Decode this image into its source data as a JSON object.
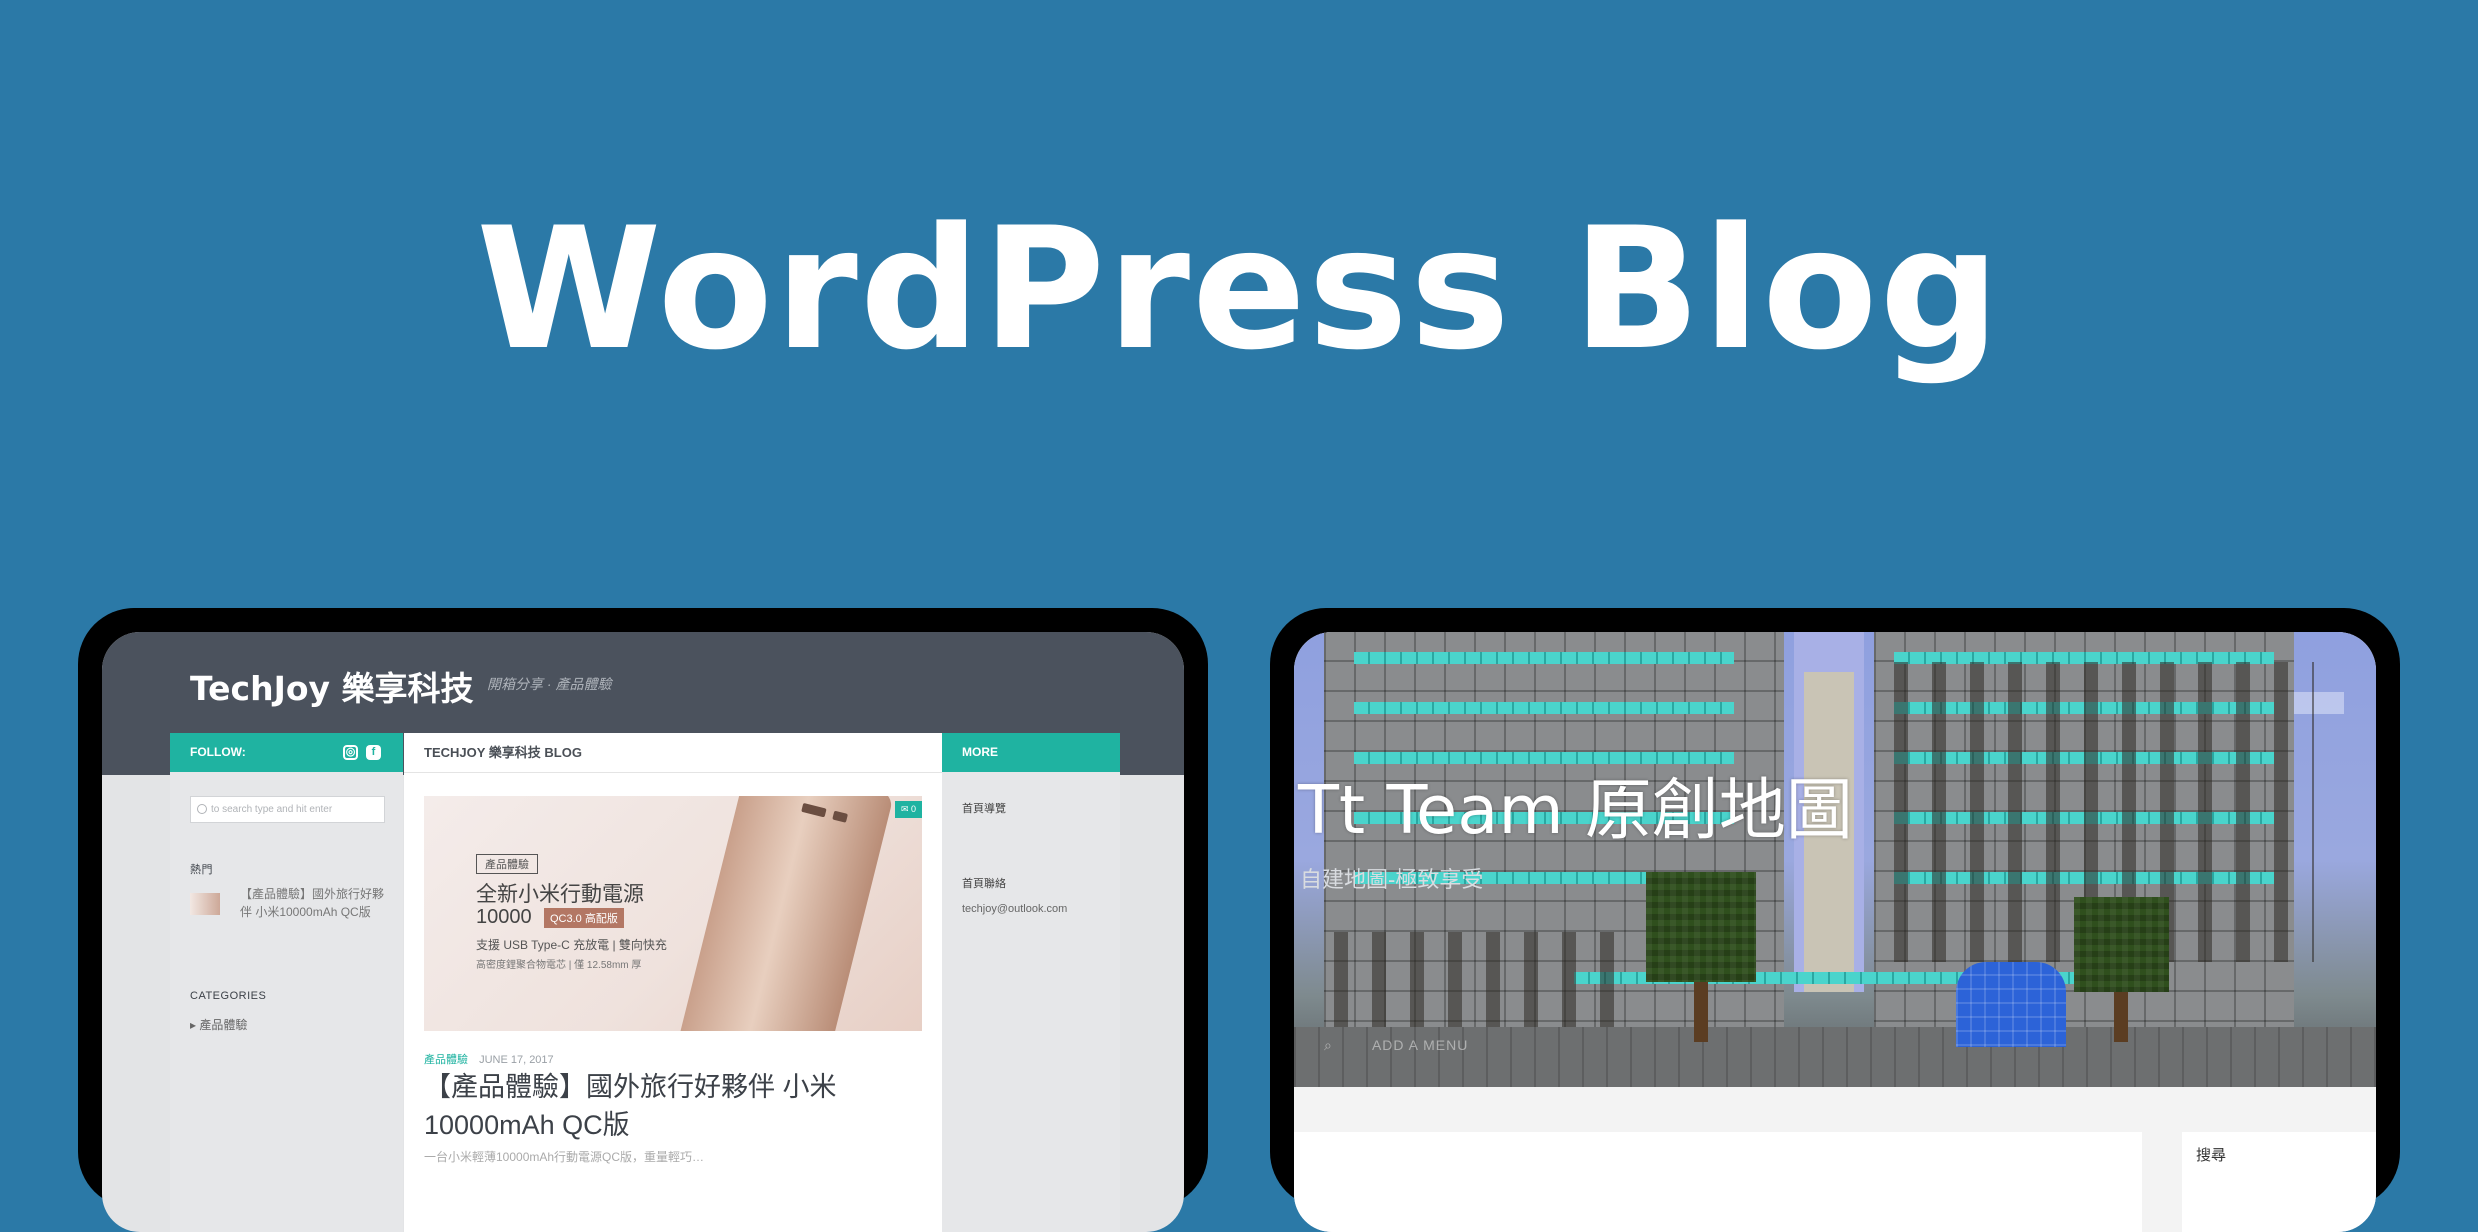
{
  "headline": "WordPress Blog",
  "left_screen": {
    "logo": "TechJoy 樂享科技",
    "tagline": "開箱分享 · 產品體驗",
    "follow_label": "FOLLOW:",
    "blog_label": "TECHJOY 樂享科技 BLOG",
    "more_label": "MORE",
    "search_placeholder": "to search type and hit enter",
    "hot_label": "熱門",
    "hot_post": "【產品體驗】國外旅行好夥伴 小米10000mAh QC版",
    "categories_label": "CATEGORIES",
    "category_item": "產品體驗",
    "ad": {
      "tag": "產品體驗",
      "title": "全新小米行動電源",
      "capacity": "10000",
      "badge": "QC3.0 高配版",
      "subtitle": "支援 USB Type-C 充放電 | 雙向快充",
      "small": "高密度鋰聚合物電芯 | 僅 12.58mm 厚"
    },
    "comment_count": "0",
    "post_category": "產品體驗",
    "post_date": "JUNE 17, 2017",
    "post_title": "【產品體驗】國外旅行好夥伴 小米10000mAh QC版",
    "post_excerpt": "一台小米輕薄10000mAh行動電源QC版，重量輕巧…",
    "more_links": [
      "首頁導覽",
      "首頁聯絡"
    ],
    "email": "techjoy@outlook.com"
  },
  "right_screen": {
    "site_title": "Tt Team 原創地圖",
    "site_tagline": "自建地圖-極致享受",
    "nav_text": "ADD A MENU",
    "search_title": "搜尋"
  }
}
